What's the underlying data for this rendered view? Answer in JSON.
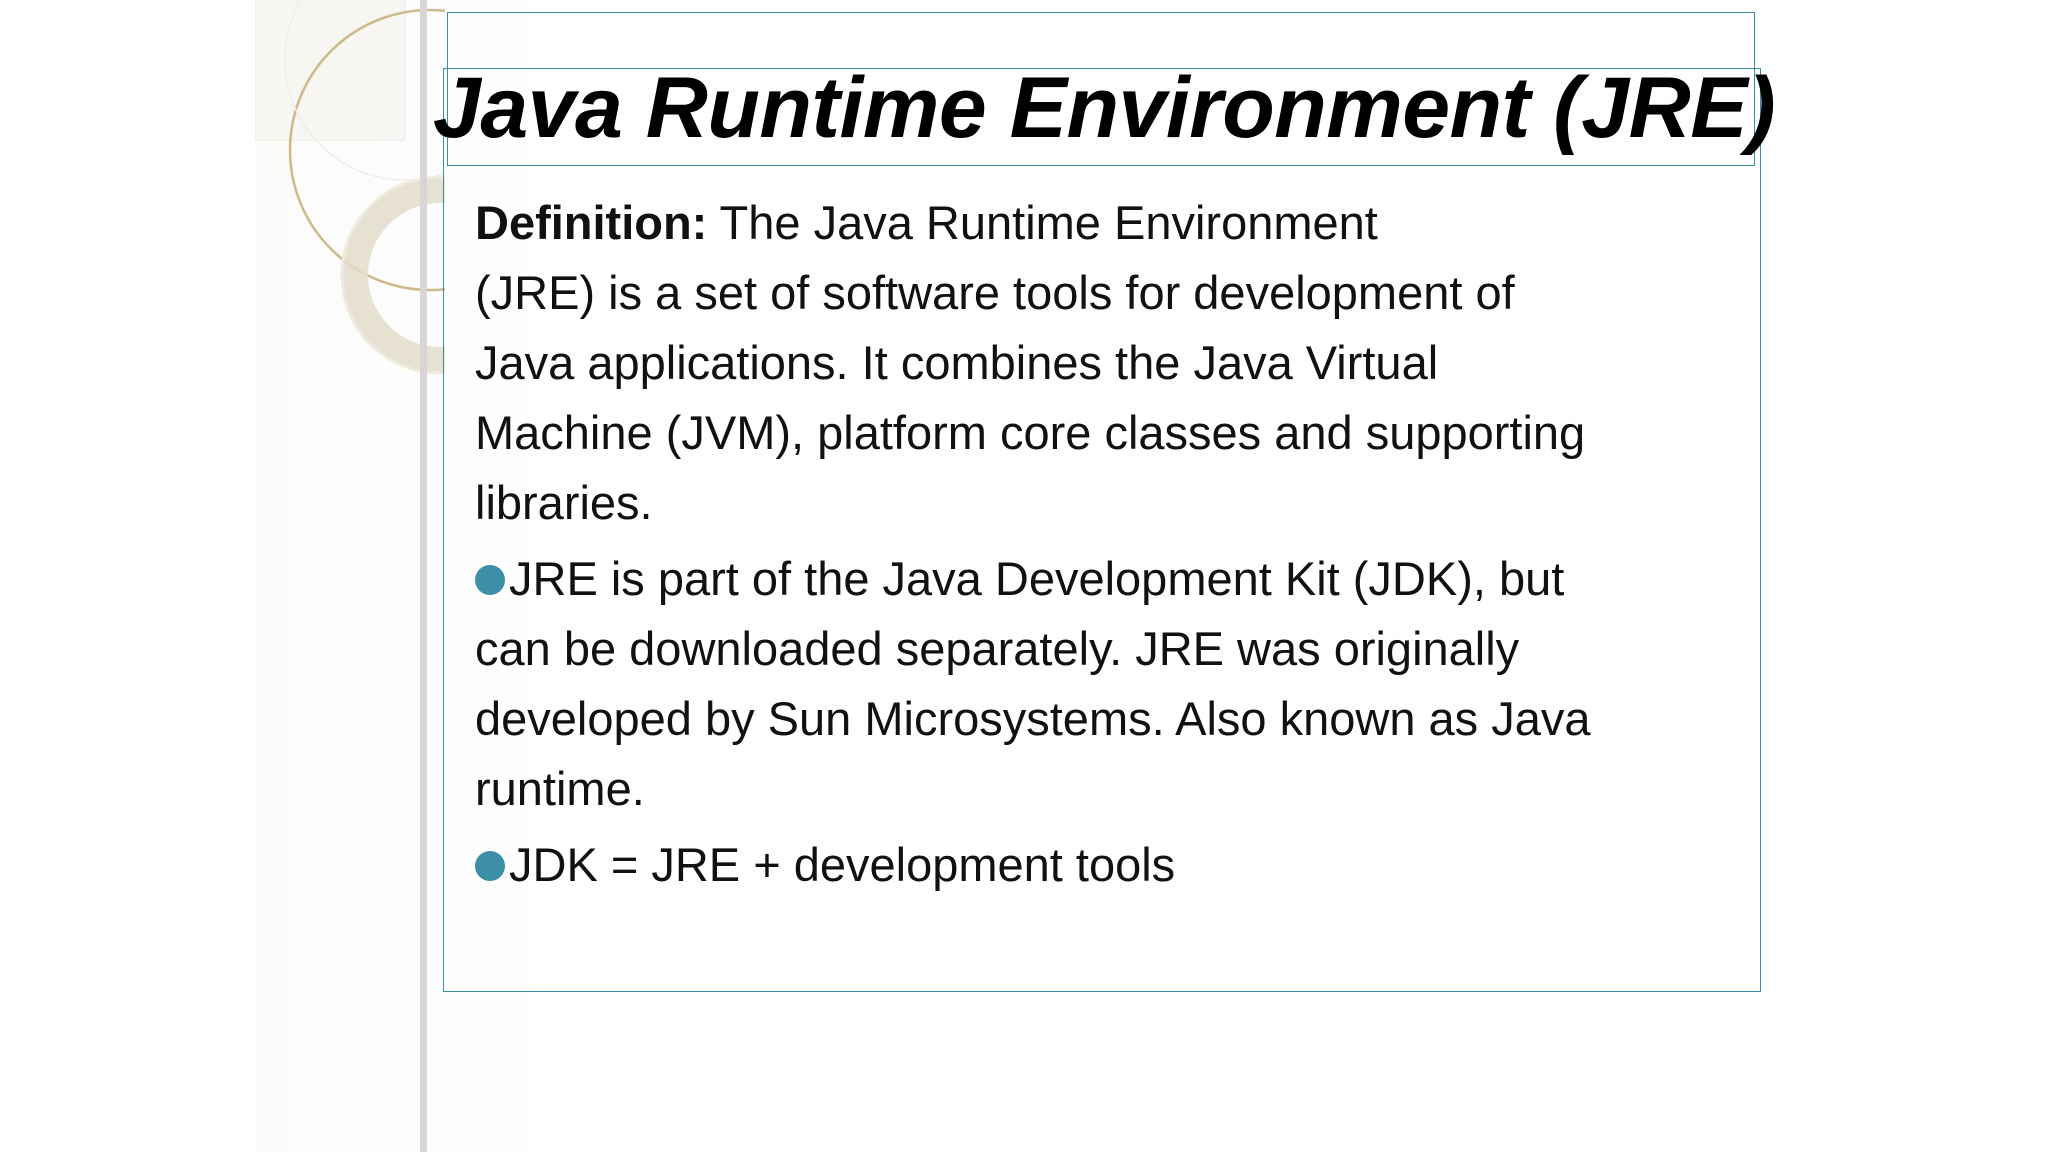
{
  "slide": {
    "title": "Java Runtime Environment (JRE)",
    "definition_label": "Definition:",
    "definition_line1": " The Java Runtime Environment",
    "definition_line2": "(JRE) is a set of software tools for development of",
    "definition_line3": "Java applications. It combines  the Java Virtual",
    "definition_line4": "Machine (JVM), platform core classes and supporting",
    "definition_line5": "libraries.",
    "bullets": [
      {
        "line1": "JRE is part of the Java Development Kit (JDK), but",
        "line2": "can be downloaded separately. JRE was originally",
        "line3": "developed by Sun Microsystems. Also known as Java",
        "line4": "runtime."
      },
      {
        "line1": "JDK = JRE + development tools"
      }
    ]
  },
  "colors": {
    "accent": "#3c8fa6",
    "frame": "#3a8ea5",
    "text": "#111111"
  },
  "icons": {
    "bullet": "circle-bullet-icon",
    "decoration": "ring-decoration"
  }
}
